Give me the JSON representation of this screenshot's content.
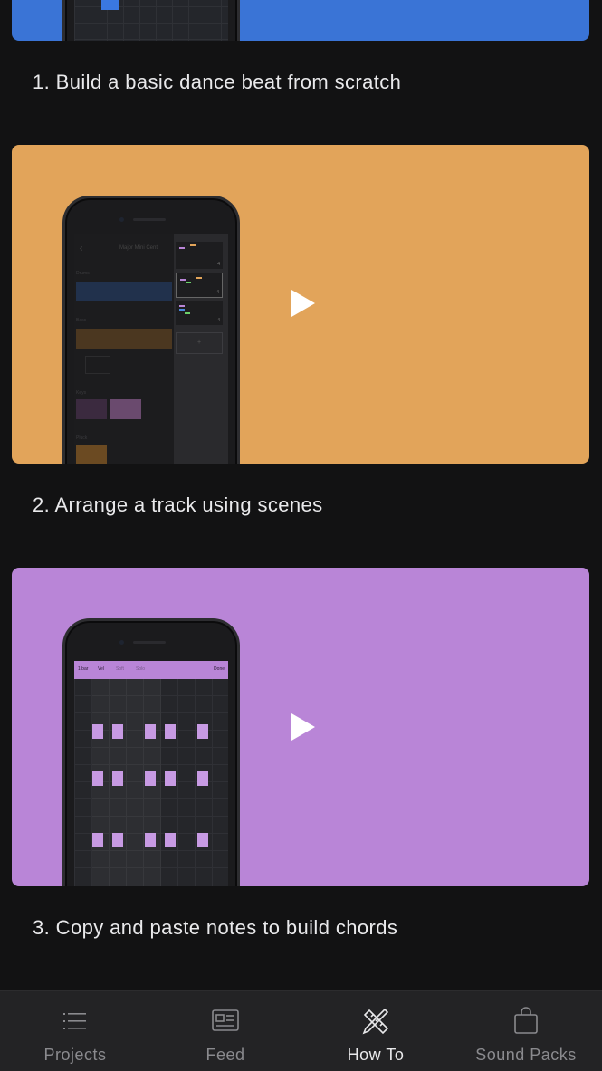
{
  "tutorials": [
    {
      "caption": "1. Build a basic dance beat from scratch",
      "color": "#3a74d6"
    },
    {
      "caption": "2. Arrange a track using scenes",
      "color": "#e2a45a"
    },
    {
      "caption": "3. Copy and paste notes to build chords",
      "color": "#b985d7"
    }
  ],
  "phone_screen2": {
    "header": "Major Mini Cent",
    "section_labels": [
      "Drums",
      "Bass",
      "Keys",
      "Pluck"
    ],
    "scene_counts": [
      "4",
      "4",
      "4"
    ],
    "add_label": "+"
  },
  "phone_screen3": {
    "toolbar": [
      "1 bar",
      "Vel",
      "Soft",
      "Solo"
    ],
    "done": "Done"
  },
  "tabbar": {
    "tabs": [
      {
        "label": "Projects",
        "icon": "list-icon",
        "active": false
      },
      {
        "label": "Feed",
        "icon": "news-icon",
        "active": false
      },
      {
        "label": "How To",
        "icon": "pencil-ruler-icon",
        "active": true
      },
      {
        "label": "Sound Packs",
        "icon": "bag-icon",
        "active": false
      }
    ]
  },
  "colors": {
    "background": "#121213",
    "tabbar": "#232325",
    "active_tab": "#e8e8ea",
    "inactive_tab": "#8a8a8e"
  }
}
